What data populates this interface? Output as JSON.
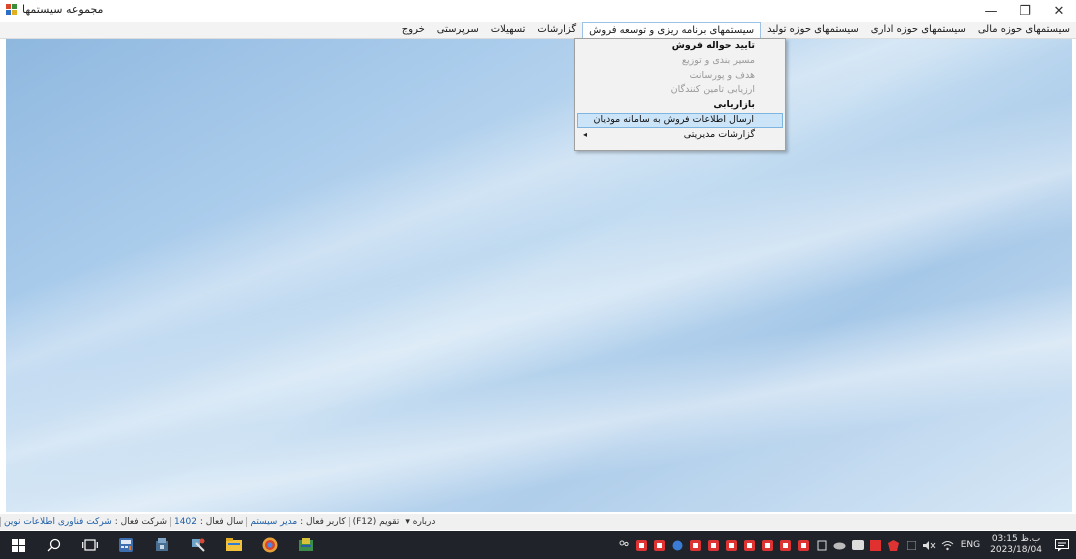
{
  "window": {
    "title": "مجموعه سیستمها",
    "controls": {
      "minimize": "—",
      "restore": "❐",
      "close": "✕"
    }
  },
  "menubar": {
    "items": [
      {
        "label": "سیستمهای حوزه مالی"
      },
      {
        "label": "سیستمهای حوزه اداری"
      },
      {
        "label": "سیستمهای حوزه تولید"
      },
      {
        "label": "سیستمهای برنامه ریزی و توسعه فروش",
        "active": true
      },
      {
        "label": "گزارشات"
      },
      {
        "label": "تسهیلات"
      },
      {
        "label": "سرپرستی"
      },
      {
        "label": "خروج"
      }
    ]
  },
  "dropdown": {
    "items": [
      {
        "label": "تایید حواله فروش",
        "state": "bold"
      },
      {
        "label": "مسیر بندی و توزیع",
        "state": "disabled"
      },
      {
        "label": "هدف و پورسانت",
        "state": "disabled"
      },
      {
        "label": "ارزیابی تامین کنندگان",
        "state": "disabled"
      },
      {
        "label": "بازاریابی",
        "state": "bold"
      },
      {
        "label": "ارسال اطلاعات فروش به سامانه مودیان",
        "state": "highlight"
      },
      {
        "label": "گزارشات مدیریتی",
        "state": "normal",
        "submenu_arrow": "◂"
      }
    ]
  },
  "statusbar": {
    "active_company_label": "شرکت فعال :",
    "active_company_value": "شرکت فناوری اطلاعات نوین",
    "active_year_label": "سال فعال :",
    "active_year_value": "1402",
    "active_user_label": "کاربر فعال :",
    "active_user_value": "مدیر سیستم",
    "calendar": "تقویم (F12)",
    "about": "درباره ▾"
  },
  "taskbar": {
    "language": "ENG",
    "time": "03:15 ب.ظ",
    "date": "2023/18/04"
  },
  "colors": {
    "taskbar_bg": "#20232a",
    "menu_highlight": "#cce4f7",
    "desktop_blue": "#a9cbeb"
  }
}
